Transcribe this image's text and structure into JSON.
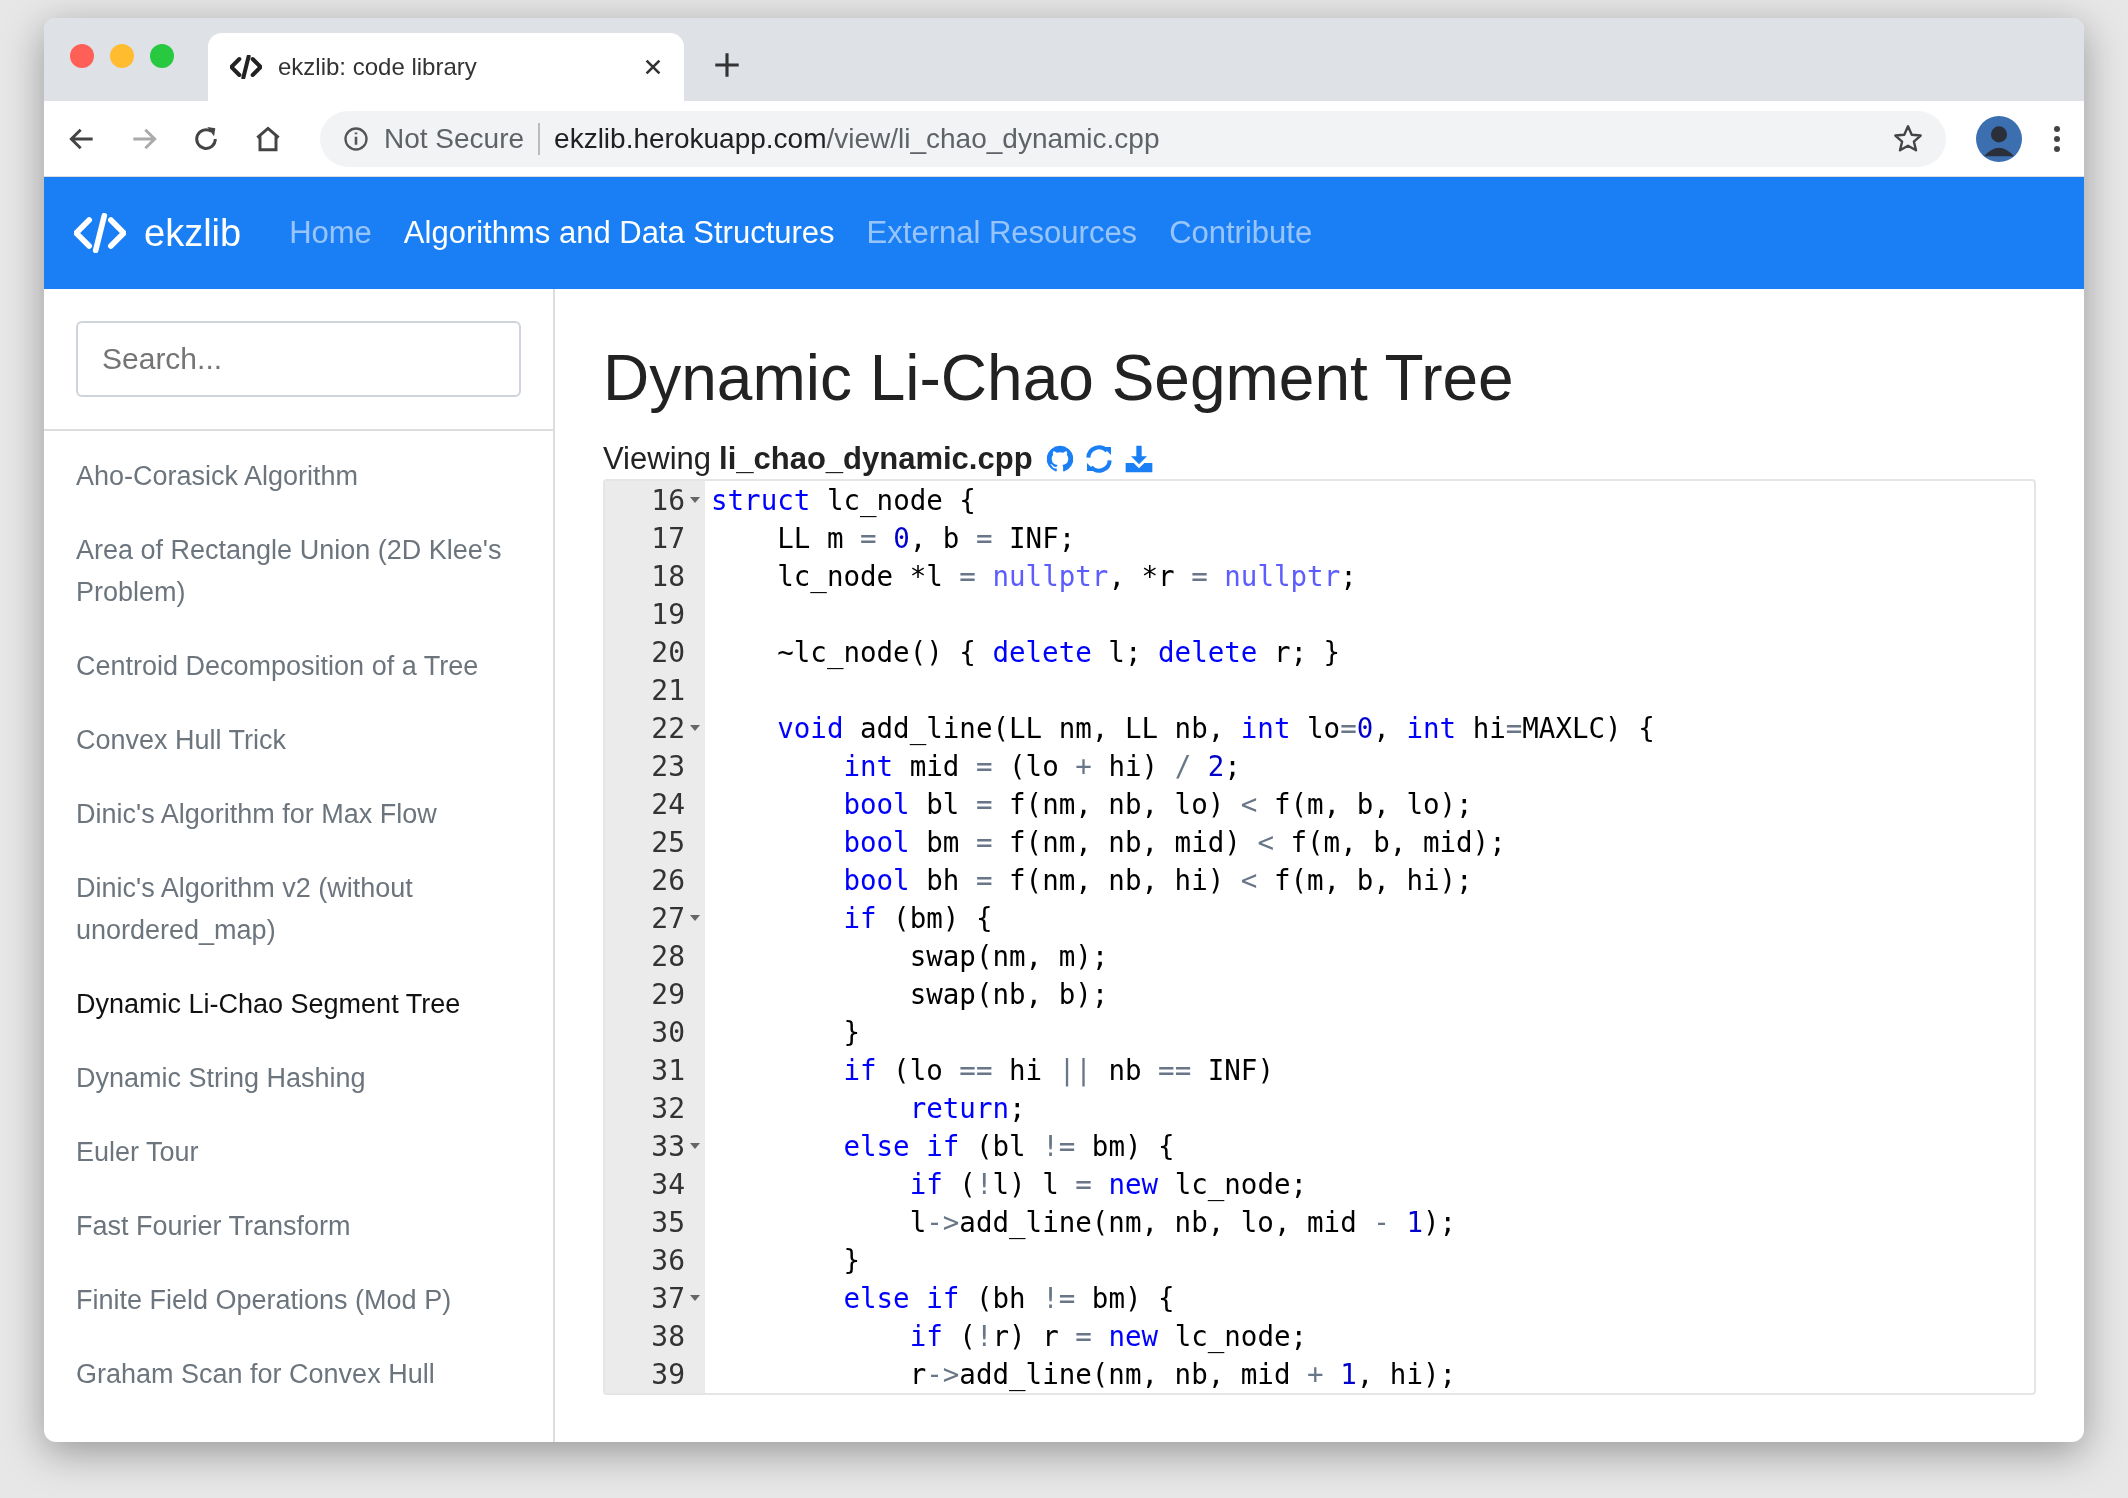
{
  "browser": {
    "tab_title": "ekzlib: code library",
    "security": "Not Secure",
    "url_host": "ekzlib.herokuapp.com",
    "url_path": "/view/li_chao_dynamic.cpp"
  },
  "navbar": {
    "brand": "ekzlib",
    "links": [
      {
        "label": "Home",
        "selected": false
      },
      {
        "label": "Algorithms and Data Structures",
        "selected": true
      },
      {
        "label": "External Resources",
        "selected": false
      },
      {
        "label": "Contribute",
        "selected": false
      }
    ]
  },
  "sidebar": {
    "search": {
      "placeholder": "Search..."
    },
    "items": [
      {
        "label": "Aho-Corasick Algorithm",
        "selected": false
      },
      {
        "label": "Area of Rectangle Union (2D Klee's Problem)",
        "selected": false
      },
      {
        "label": "Centroid Decomposition of a Tree",
        "selected": false
      },
      {
        "label": "Convex Hull Trick",
        "selected": false
      },
      {
        "label": "Dinic's Algorithm for Max Flow",
        "selected": false
      },
      {
        "label": "Dinic's Algorithm v2 (without unordered_map)",
        "selected": false
      },
      {
        "label": "Dynamic Li-Chao Segment Tree",
        "selected": true
      },
      {
        "label": "Dynamic String Hashing",
        "selected": false
      },
      {
        "label": "Euler Tour",
        "selected": false
      },
      {
        "label": "Fast Fourier Transform",
        "selected": false
      },
      {
        "label": "Finite Field Operations (Mod P)",
        "selected": false
      },
      {
        "label": "Graham Scan for Convex Hull",
        "selected": false
      }
    ]
  },
  "main": {
    "title": "Dynamic Li-Chao Segment Tree",
    "viewing_label": "Viewing",
    "filename": "li_chao_dynamic.cpp",
    "code_lines": [
      {
        "number": "16",
        "foldable": true,
        "tokens": [
          {
            "text": "struct",
            "kind": "keyword"
          },
          {
            "text": " lc_node {",
            "kind": "plain"
          }
        ]
      },
      {
        "number": "17",
        "foldable": false,
        "tokens": [
          {
            "text": "    LL m ",
            "kind": "plain"
          },
          {
            "text": "= ",
            "kind": "operator"
          },
          {
            "text": "0",
            "kind": "number"
          },
          {
            "text": ", b ",
            "kind": "plain"
          },
          {
            "text": "=",
            "kind": "operator"
          },
          {
            "text": " INF;",
            "kind": "plain"
          }
        ]
      },
      {
        "number": "18",
        "foldable": false,
        "tokens": [
          {
            "text": "    lc_node *l ",
            "kind": "plain"
          },
          {
            "text": "= ",
            "kind": "operator"
          },
          {
            "text": "nullptr",
            "kind": "constant"
          },
          {
            "text": ", *r ",
            "kind": "plain"
          },
          {
            "text": "= ",
            "kind": "operator"
          },
          {
            "text": "nullptr",
            "kind": "constant"
          },
          {
            "text": ";",
            "kind": "plain"
          }
        ]
      },
      {
        "number": "19",
        "foldable": false
      },
      {
        "number": "20",
        "foldable": false,
        "tokens": [
          {
            "text": "    ~lc_node() { ",
            "kind": "plain"
          },
          {
            "text": "delete",
            "kind": "keyword"
          },
          {
            "text": " l; ",
            "kind": "plain"
          },
          {
            "text": "delete",
            "kind": "keyword"
          },
          {
            "text": " r; }",
            "kind": "plain"
          }
        ]
      },
      {
        "number": "21",
        "foldable": false
      },
      {
        "number": "22",
        "foldable": true,
        "tokens": [
          {
            "text": "    void",
            "kind": "keyword"
          },
          {
            "text": " add_line(LL nm, LL nb, ",
            "kind": "plain"
          },
          {
            "text": "int",
            "kind": "keyword"
          },
          {
            "text": " lo",
            "kind": "plain"
          },
          {
            "text": "=",
            "kind": "operator"
          },
          {
            "text": "0",
            "kind": "number"
          },
          {
            "text": ", ",
            "kind": "plain"
          },
          {
            "text": "int",
            "kind": "keyword"
          },
          {
            "text": " hi",
            "kind": "plain"
          },
          {
            "text": "=",
            "kind": "operator"
          },
          {
            "text": "MAXLC) {",
            "kind": "plain"
          }
        ]
      },
      {
        "number": "23",
        "foldable": false,
        "tokens": [
          {
            "text": "        int",
            "kind": "keyword"
          },
          {
            "text": " mid ",
            "kind": "plain"
          },
          {
            "text": "=",
            "kind": "operator"
          },
          {
            "text": " (lo ",
            "kind": "plain"
          },
          {
            "text": "+",
            "kind": "operator"
          },
          {
            "text": " hi) ",
            "kind": "plain"
          },
          {
            "text": "/ ",
            "kind": "operator"
          },
          {
            "text": "2",
            "kind": "number"
          },
          {
            "text": ";",
            "kind": "plain"
          }
        ]
      },
      {
        "number": "24",
        "foldable": false,
        "tokens": [
          {
            "text": "        bool",
            "kind": "keyword"
          },
          {
            "text": " bl ",
            "kind": "plain"
          },
          {
            "text": "=",
            "kind": "operator"
          },
          {
            "text": " f(nm, nb, lo) ",
            "kind": "plain"
          },
          {
            "text": "<",
            "kind": "operator"
          },
          {
            "text": " f(m, b, lo);",
            "kind": "plain"
          }
        ]
      },
      {
        "number": "25",
        "foldable": false,
        "tokens": [
          {
            "text": "        bool",
            "kind": "keyword"
          },
          {
            "text": " bm ",
            "kind": "plain"
          },
          {
            "text": "=",
            "kind": "operator"
          },
          {
            "text": " f(nm, nb, mid) ",
            "kind": "plain"
          },
          {
            "text": "<",
            "kind": "operator"
          },
          {
            "text": " f(m, b, mid);",
            "kind": "plain"
          }
        ]
      },
      {
        "number": "26",
        "foldable": false,
        "tokens": [
          {
            "text": "        bool",
            "kind": "keyword"
          },
          {
            "text": " bh ",
            "kind": "plain"
          },
          {
            "text": "=",
            "kind": "operator"
          },
          {
            "text": " f(nm, nb, hi) ",
            "kind": "plain"
          },
          {
            "text": "<",
            "kind": "operator"
          },
          {
            "text": " f(m, b, hi);",
            "kind": "plain"
          }
        ]
      },
      {
        "number": "27",
        "foldable": true,
        "tokens": [
          {
            "text": "        if",
            "kind": "keyword"
          },
          {
            "text": " (bm) {",
            "kind": "plain"
          }
        ]
      },
      {
        "number": "28",
        "foldable": false,
        "tokens": [
          {
            "text": "            swap(nm, m);",
            "kind": "plain"
          }
        ]
      },
      {
        "number": "29",
        "foldable": false,
        "tokens": [
          {
            "text": "            swap(nb, b);",
            "kind": "plain"
          }
        ]
      },
      {
        "number": "30",
        "foldable": false,
        "tokens": [
          {
            "text": "        }",
            "kind": "plain"
          }
        ]
      },
      {
        "number": "31",
        "foldable": false,
        "tokens": [
          {
            "text": "        if",
            "kind": "keyword"
          },
          {
            "text": " (lo ",
            "kind": "plain"
          },
          {
            "text": "==",
            "kind": "operator"
          },
          {
            "text": " hi ",
            "kind": "plain"
          },
          {
            "text": "||",
            "kind": "operator"
          },
          {
            "text": " nb ",
            "kind": "plain"
          },
          {
            "text": "==",
            "kind": "operator"
          },
          {
            "text": " INF)",
            "kind": "plain"
          }
        ]
      },
      {
        "number": "32",
        "foldable": false,
        "tokens": [
          {
            "text": "            return",
            "kind": "keyword"
          },
          {
            "text": ";",
            "kind": "plain"
          }
        ]
      },
      {
        "number": "33",
        "foldable": true,
        "tokens": [
          {
            "text": "        else if",
            "kind": "keyword"
          },
          {
            "text": " (bl ",
            "kind": "plain"
          },
          {
            "text": "!=",
            "kind": "operator"
          },
          {
            "text": " bm) {",
            "kind": "plain"
          }
        ]
      },
      {
        "number": "34",
        "foldable": false,
        "tokens": [
          {
            "text": "            if",
            "kind": "keyword"
          },
          {
            "text": " (",
            "kind": "plain"
          },
          {
            "text": "!",
            "kind": "operator"
          },
          {
            "text": "l) l ",
            "kind": "plain"
          },
          {
            "text": "= ",
            "kind": "operator"
          },
          {
            "text": "new",
            "kind": "keyword"
          },
          {
            "text": " lc_node;",
            "kind": "plain"
          }
        ]
      },
      {
        "number": "35",
        "foldable": false,
        "tokens": [
          {
            "text": "            l",
            "kind": "plain"
          },
          {
            "text": "->",
            "kind": "operator"
          },
          {
            "text": "add_line(nm, nb, lo, mid ",
            "kind": "plain"
          },
          {
            "text": "- ",
            "kind": "operator"
          },
          {
            "text": "1",
            "kind": "number"
          },
          {
            "text": ");",
            "kind": "plain"
          }
        ]
      },
      {
        "number": "36",
        "foldable": false,
        "tokens": [
          {
            "text": "        }",
            "kind": "plain"
          }
        ]
      },
      {
        "number": "37",
        "foldable": true,
        "tokens": [
          {
            "text": "        else if",
            "kind": "keyword"
          },
          {
            "text": " (bh ",
            "kind": "plain"
          },
          {
            "text": "!=",
            "kind": "operator"
          },
          {
            "text": " bm) {",
            "kind": "plain"
          }
        ]
      },
      {
        "number": "38",
        "foldable": false,
        "tokens": [
          {
            "text": "            if",
            "kind": "keyword"
          },
          {
            "text": " (",
            "kind": "plain"
          },
          {
            "text": "!",
            "kind": "operator"
          },
          {
            "text": "r) r ",
            "kind": "plain"
          },
          {
            "text": "= ",
            "kind": "operator"
          },
          {
            "text": "new",
            "kind": "keyword"
          },
          {
            "text": " lc_node;",
            "kind": "plain"
          }
        ]
      },
      {
        "number": "39",
        "foldable": false,
        "tokens": [
          {
            "text": "            r",
            "kind": "plain"
          },
          {
            "text": "->",
            "kind": "operator"
          },
          {
            "text": "add_line(nm, nb, mid ",
            "kind": "plain"
          },
          {
            "text": "+ ",
            "kind": "operator"
          },
          {
            "text": "1",
            "kind": "number"
          },
          {
            "text": ", hi);",
            "kind": "plain"
          }
        ]
      }
    ]
  }
}
